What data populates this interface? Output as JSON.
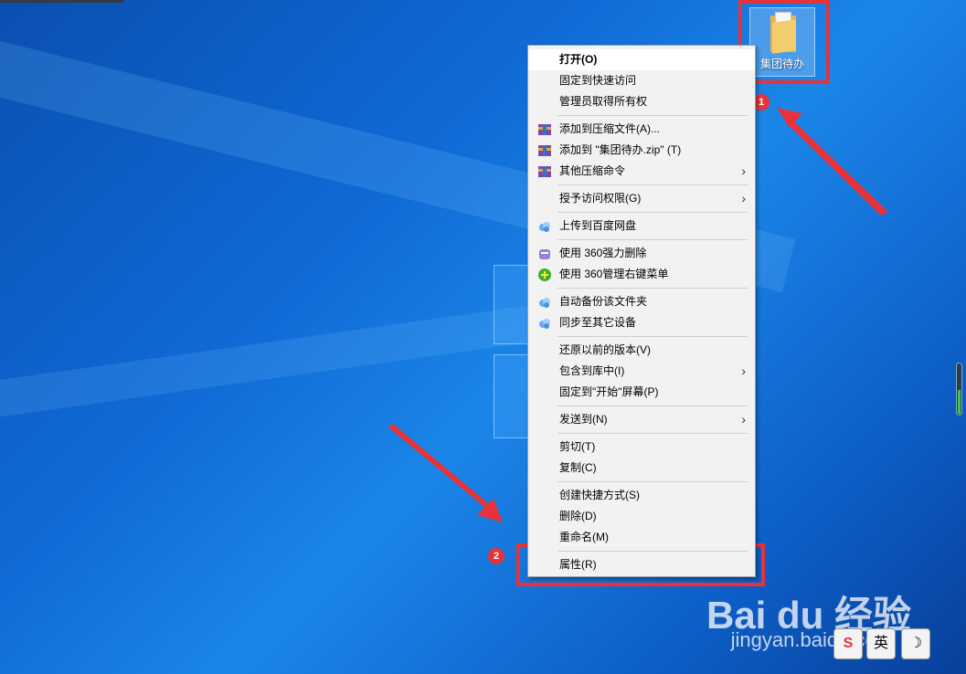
{
  "desktop": {
    "folder": {
      "label": "集团待办",
      "icon": "folder-icon"
    }
  },
  "annotations": {
    "badge_1": "1",
    "badge_2": "2",
    "accent_color": "#e8323a"
  },
  "context_menu": {
    "groups": [
      [
        {
          "label": "打开(O)",
          "bold": true
        },
        {
          "label": "固定到快速访问"
        },
        {
          "label": "管理员取得所有权"
        }
      ],
      [
        {
          "label": "添加到压缩文件(A)...",
          "icon": "winrar-icon"
        },
        {
          "label": "添加到 \"集团待办.zip\" (T)",
          "icon": "winrar-icon"
        },
        {
          "label": "其他压缩命令",
          "icon": "winrar-icon",
          "submenu": true
        }
      ],
      [
        {
          "label": "授予访问权限(G)",
          "submenu": true
        }
      ],
      [
        {
          "label": "上传到百度网盘",
          "icon": "baidu-cloud-icon"
        }
      ],
      [
        {
          "label": "使用 360强力删除",
          "icon": "360-delete-icon"
        },
        {
          "label": "使用 360管理右键菜单",
          "icon": "360-plus-icon"
        }
      ],
      [
        {
          "label": "自动备份该文件夹",
          "icon": "baidu-cloud-icon"
        },
        {
          "label": "同步至其它设备",
          "icon": "baidu-cloud-icon"
        }
      ],
      [
        {
          "label": "还原以前的版本(V)"
        },
        {
          "label": "包含到库中(I)",
          "submenu": true
        },
        {
          "label": "固定到\"开始\"屏幕(P)"
        }
      ],
      [
        {
          "label": "发送到(N)",
          "submenu": true
        }
      ],
      [
        {
          "label": "剪切(T)"
        },
        {
          "label": "复制(C)"
        }
      ],
      [
        {
          "label": "创建快捷方式(S)"
        },
        {
          "label": "删除(D)"
        },
        {
          "label": "重命名(M)"
        }
      ],
      [
        {
          "label": "属性(R)"
        }
      ]
    ],
    "submenu_glyph": "›"
  },
  "watermark": {
    "logo": "Bai du 经验",
    "url": "jingyan.baidu.com"
  },
  "tray": {
    "ime_icon": "S",
    "lang": "英",
    "moon": "☽"
  }
}
